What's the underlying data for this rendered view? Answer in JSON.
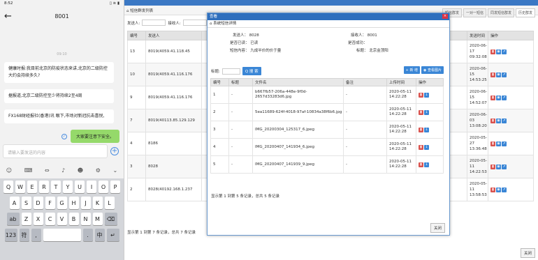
{
  "phone": {
    "time": "8:52",
    "status_icons": "▯ ≋ ▮",
    "title": "8001",
    "timestamp": "09:10",
    "messages": [
      "健康时报:我目前北京的防疫状态来讲,北京的二级防控大约会持续多久?",
      "据报道,北京二级防控至少将持续2至4周",
      "FX168财经报社(香港)讯 眼下,市场对新冠抗击喜悦,"
    ],
    "my_message": "大家要注意下安全。",
    "input_placeholder": "请输入要发送的内容",
    "keys_row1": [
      "Q",
      "W",
      "E",
      "R",
      "T",
      "Y",
      "U",
      "I",
      "O",
      "P"
    ],
    "keys_row2": [
      "A",
      "S",
      "D",
      "F",
      "G",
      "H",
      "J",
      "K",
      "L"
    ],
    "keys_row3": [
      "Z",
      "X",
      "C",
      "V",
      "B",
      "N",
      "M"
    ],
    "key_shift": "ab",
    "key_del": "⌫",
    "key_num": "123",
    "key_sym": "符",
    "key_comma": ",",
    "key_space": "",
    "key_period": ".",
    "key_lang": "中",
    "key_enter": "↵"
  },
  "desk": {
    "crumb": "⌂ 短信群发列表",
    "tabs": [
      "短信群发",
      "一对一短信",
      "同发短信群发",
      "历史群发"
    ],
    "filter": {
      "sender": "发送人:",
      "receiver": "接收人:"
    },
    "columns": [
      "编号",
      "发送人",
      "",
      "",
      "发送时间",
      "操作"
    ],
    "rows": [
      {
        "id": "13",
        "sender": "8019(4059.41.118.45",
        "time": "2020-06-17 09:32:08"
      },
      {
        "id": "10",
        "sender": "8019(4059.41.116.176",
        "time": "2020-06-15 14:53:25"
      },
      {
        "id": "9",
        "sender": "8019(4059.41.116.176",
        "time": "2020-06-15 14:52:07"
      },
      {
        "id": "7",
        "sender": "8019(40113.85.129.129",
        "time": "2020-06-03 13:08:20"
      },
      {
        "id": "4",
        "sender": "8186",
        "time": "2020-05-27 13:36:48"
      },
      {
        "id": "3",
        "sender": "8028",
        "time": "2020-05-11 14:22:53"
      },
      {
        "id": "2",
        "sender": "8028(40192.168.1.237",
        "time": "2020-05-11 13:58:53"
      }
    ],
    "footer": "显示第 1 到第 7 条记录，总共 7 条记录",
    "close": "关闭"
  },
  "modal": {
    "title": "查看",
    "sub": "⌂ 系统短信详情",
    "sender_label": "发送人：",
    "sender": "8028",
    "receiver_label": "接收人：",
    "receiver": "8001",
    "read_label": "是否已读：",
    "read": "已读",
    "success_label": "是否成功：",
    "success": "",
    "content_label": "短信内容：",
    "content": "九成半价的价于量",
    "title_label": "标题：",
    "title_val": "北京金顶阳",
    "search_label": "标题:",
    "search_btn": "Q 搜 索",
    "add_btn": "+ 新 增",
    "view_btn": "◉ 查看图片",
    "columns": [
      "编号",
      "标题",
      "文件名",
      "备注",
      "上传时间",
      "操作"
    ],
    "rows": [
      {
        "id": "1",
        "title": "-",
        "file": "b667fb57-206a-448e-9f0d-2657d33283d6.jpg",
        "note": "-",
        "time": "2020-05-11 14:22:28"
      },
      {
        "id": "2",
        "title": "-",
        "file": "5ea11689-624f-4018-97af-10834a38f6b6.jpg",
        "note": "-",
        "time": "2020-05-11 14:22:28"
      },
      {
        "id": "3",
        "title": "-",
        "file": "IMG_20200304_125317_6.jpeg",
        "note": "-",
        "time": "2020-05-11 14:22:28"
      },
      {
        "id": "4",
        "title": "-",
        "file": "IMG_20200407_141934_6.jpeg",
        "note": "-",
        "time": "2020-05-11 14:22:28"
      },
      {
        "id": "5",
        "title": "-",
        "file": "IMG_20200407_141939_9.jpeg",
        "note": "-",
        "time": "2020-05-11 14:22:28"
      }
    ],
    "footer": "显示第 1 到第 5 条记录，总共 5 条记录",
    "close": "关闭"
  },
  "colors": {
    "accent": "#3a86d6",
    "danger": "#d9534f",
    "bubble_me": "#95d96a"
  }
}
